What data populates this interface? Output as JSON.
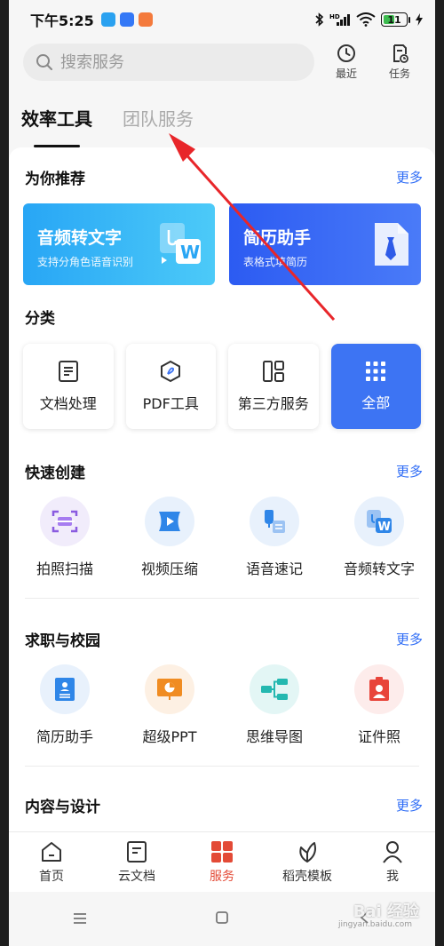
{
  "status_bar": {
    "time": "下午5:25",
    "battery": "11",
    "app_badges": [
      "#2aa1f0",
      "#3478f6",
      "#f47a3c"
    ]
  },
  "search": {
    "placeholder": "搜索服务"
  },
  "top_actions": [
    {
      "label": "最近",
      "icon": "clock-icon"
    },
    {
      "label": "任务",
      "icon": "task-icon"
    }
  ],
  "tabs": [
    {
      "label": "效率工具",
      "active": true
    },
    {
      "label": "团队服务",
      "active": false
    }
  ],
  "recommend": {
    "title": "为你推荐",
    "more": "更多",
    "cards": [
      {
        "title": "音频转文字",
        "subtitle": "支持分角色语音识别",
        "icon": "audio-to-text-icon"
      },
      {
        "title": "简历助手",
        "subtitle": "表格式填简历",
        "icon": "resume-doc-icon"
      }
    ]
  },
  "category": {
    "title": "分类",
    "items": [
      {
        "label": "文档处理",
        "icon": "document-icon"
      },
      {
        "label": "PDF工具",
        "icon": "pdf-icon"
      },
      {
        "label": "第三方服务",
        "icon": "grid-layout-icon"
      },
      {
        "label": "全部",
        "icon": "dots-grid-icon",
        "active": true
      }
    ]
  },
  "quick_create": {
    "title": "快速创建",
    "more": "更多",
    "items": [
      {
        "label": "拍照扫描",
        "icon": "scan-icon"
      },
      {
        "label": "视频压缩",
        "icon": "video-compress-icon"
      },
      {
        "label": "语音速记",
        "icon": "voice-note-icon"
      },
      {
        "label": "音频转文字",
        "icon": "audio-word-icon"
      }
    ]
  },
  "career": {
    "title": "求职与校园",
    "more": "更多",
    "items": [
      {
        "label": "简历助手",
        "icon": "resume-icon"
      },
      {
        "label": "超级PPT",
        "icon": "ppt-icon"
      },
      {
        "label": "思维导图",
        "icon": "mindmap-icon"
      },
      {
        "label": "证件照",
        "icon": "id-photo-icon"
      }
    ]
  },
  "content_design": {
    "title": "内容与设计",
    "more": "更多"
  },
  "bottom_nav": [
    {
      "label": "首页",
      "icon": "home-icon"
    },
    {
      "label": "云文档",
      "icon": "cloud-doc-icon"
    },
    {
      "label": "服务",
      "icon": "services-icon",
      "active": true
    },
    {
      "label": "稻壳模板",
      "icon": "leaf-template-icon"
    },
    {
      "label": "我",
      "icon": "profile-icon"
    }
  ],
  "watermark": {
    "text": "Bai 经验",
    "sub": "jingyan.baidu.com"
  },
  "colors": {
    "accent": "#2f6df6",
    "active_nav": "#e34a36",
    "annotation_arrow": "#e8262a"
  }
}
